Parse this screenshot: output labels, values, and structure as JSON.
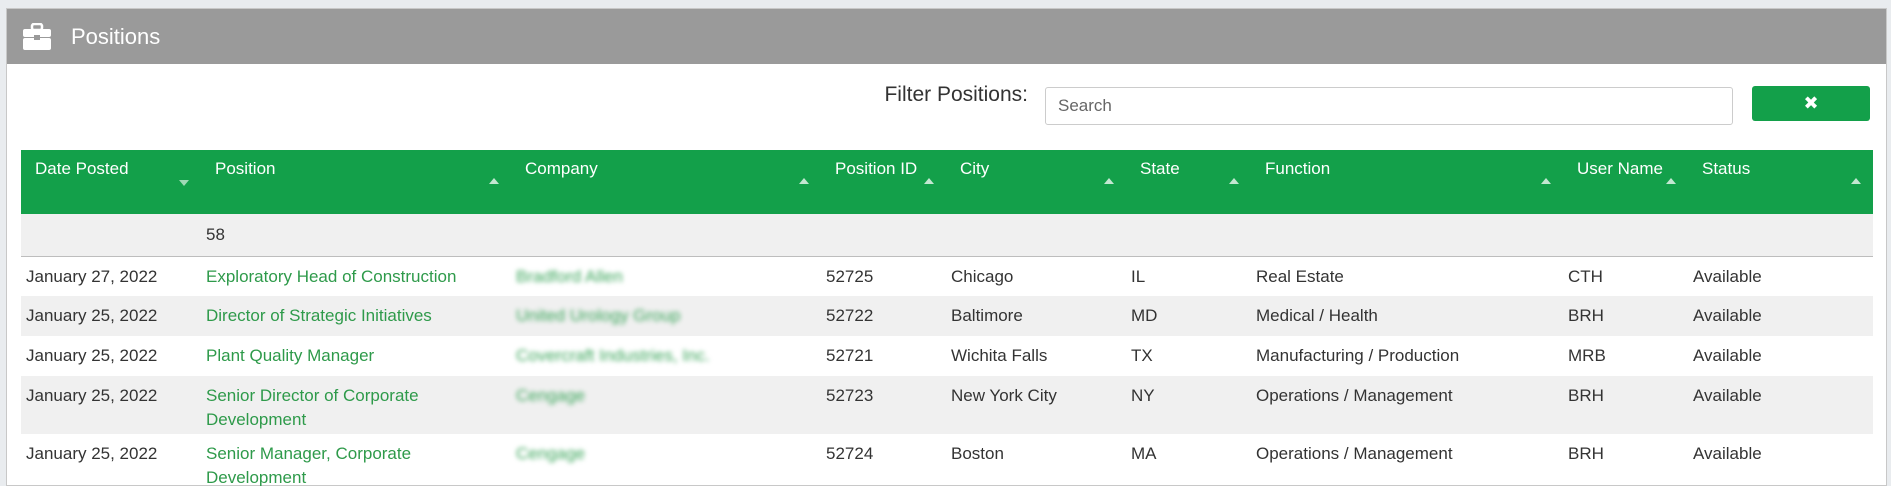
{
  "panel": {
    "title": "Positions",
    "header_icon": "briefcase-icon"
  },
  "filter": {
    "label": "Filter Positions:",
    "placeholder": "Search",
    "value": "",
    "clear_label": "✖"
  },
  "colors": {
    "header_bar": "#9a9a9a",
    "accent": "#13a04a",
    "link": "#2e9a4a"
  },
  "table": {
    "columns": [
      "Date Posted",
      "Position",
      "Company",
      "Position ID",
      "City",
      "State",
      "Function",
      "User Name",
      "Status"
    ],
    "count": "58",
    "rows": [
      {
        "date": "January 27, 2022",
        "position": "Exploratory Head of Construction",
        "company": "Bradford Allen",
        "id": "52725",
        "city": "Chicago",
        "state": "IL",
        "function": "Real Estate",
        "user": "CTH",
        "status": "Available"
      },
      {
        "date": "January 25, 2022",
        "position": "Director of Strategic Initiatives",
        "company": "United Urology Group",
        "id": "52722",
        "city": "Baltimore",
        "state": "MD",
        "function": "Medical / Health",
        "user": "BRH",
        "status": "Available"
      },
      {
        "date": "January 25, 2022",
        "position": "Plant Quality Manager",
        "company": "Covercraft Industries, Inc.",
        "id": "52721",
        "city": "Wichita Falls",
        "state": "TX",
        "function": "Manufacturing / Production",
        "user": "MRB",
        "status": "Available"
      },
      {
        "date": "January 25, 2022",
        "position": "Senior Director of Corporate Development",
        "company": "Cengage",
        "id": "52723",
        "city": "New York City",
        "state": "NY",
        "function": "Operations / Management",
        "user": "BRH",
        "status": "Available"
      },
      {
        "date": "January 25, 2022",
        "position": "Senior Manager, Corporate Development",
        "company": "Cengage",
        "id": "52724",
        "city": "Boston",
        "state": "MA",
        "function": "Operations / Management",
        "user": "BRH",
        "status": "Available"
      }
    ]
  }
}
